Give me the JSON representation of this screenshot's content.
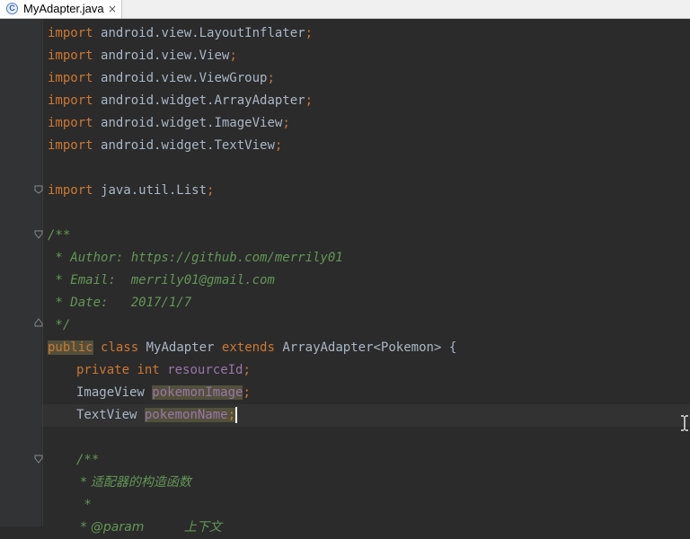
{
  "tab": {
    "icon_letter": "C",
    "label": "MyAdapter.java",
    "close_glyph": "×"
  },
  "code": {
    "l1": {
      "kw": "import",
      "rest": "android.view.LayoutInflater",
      "semi": ";"
    },
    "l2": {
      "kw": "import",
      "rest": "android.view.View",
      "semi": ";"
    },
    "l3": {
      "kw": "import",
      "rest": "android.view.ViewGroup",
      "semi": ";"
    },
    "l4": {
      "kw": "import",
      "rest": "android.widget.ArrayAdapter",
      "semi": ";"
    },
    "l5": {
      "kw": "import",
      "rest": "android.widget.ImageView",
      "semi": ";"
    },
    "l6": {
      "kw": "import",
      "rest": "android.widget.TextView",
      "semi": ";"
    },
    "l8": {
      "kw": "import",
      "rest": "java.util.List",
      "semi": ";"
    },
    "l10": {
      "text": "/**"
    },
    "l11": {
      "text": " * Author: https://github.com/merrily01"
    },
    "l12": {
      "text": " * Email:  merrily01@gmail.com"
    },
    "l13": {
      "text": " * Date:   2017/1/7"
    },
    "l14": {
      "text": " */"
    },
    "l15": {
      "kw1": "public",
      "kw2": "class",
      "name": "MyAdapter",
      "kw3": "extends",
      "type": "ArrayAdapter<Pokemon>",
      "brace": "{"
    },
    "l16": {
      "kw1": "private",
      "kw2": "int",
      "field": "resourceId",
      "semi": ";"
    },
    "l17": {
      "type": "ImageView",
      "field": "pokemonImage",
      "semi": ";"
    },
    "l18": {
      "type": "TextView",
      "field": "pokemonName",
      "semi": ";"
    },
    "l20": {
      "text": "/**"
    },
    "l21": {
      "text": " * 适配器的构造函数"
    },
    "l22": {
      "text": " *"
    },
    "l23": {
      "text": " * @param          上下文"
    }
  }
}
